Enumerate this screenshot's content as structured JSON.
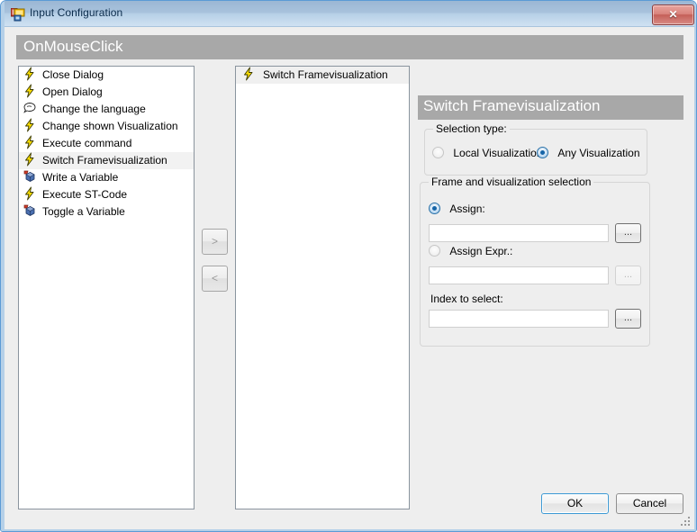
{
  "window": {
    "title": "Input Configuration",
    "icon": "windows-form-icon",
    "close_label": "✕"
  },
  "event_header": {
    "label": "OnMouseClick"
  },
  "available_list": {
    "name": "available-actions-list",
    "items": [
      {
        "label": "Close Dialog",
        "icon": "lightning-icon",
        "selected": false
      },
      {
        "label": "Open Dialog",
        "icon": "lightning-icon",
        "selected": false
      },
      {
        "label": "Change the language",
        "icon": "speech-bubble-icon",
        "selected": false
      },
      {
        "label": "Change shown Visualization",
        "icon": "lightning-icon",
        "selected": false
      },
      {
        "label": "Execute command",
        "icon": "lightning-icon",
        "selected": false
      },
      {
        "label": "Switch Framevisualization",
        "icon": "lightning-icon",
        "selected": true
      },
      {
        "label": "Write a Variable",
        "icon": "variable-icon",
        "selected": false
      },
      {
        "label": "Execute ST-Code",
        "icon": "lightning-icon",
        "selected": false
      },
      {
        "label": "Toggle a Variable",
        "icon": "variable-icon",
        "selected": false
      }
    ]
  },
  "selected_list": {
    "name": "configured-actions-list",
    "items": [
      {
        "label": "Switch Framevisualization",
        "icon": "lightning-icon",
        "selected": true
      }
    ]
  },
  "move_buttons": {
    "add_label": ">",
    "remove_label": "<"
  },
  "action_panel": {
    "title": "Switch Framevisualization",
    "selection_type": {
      "group_label": "Selection type:",
      "options": [
        {
          "label": "Local Visualization",
          "checked": false
        },
        {
          "label": "Any Visualization",
          "checked": true
        }
      ]
    },
    "frame_selection": {
      "group_label": "Frame and visualization selection",
      "assign": {
        "radio_label": "Assign:",
        "checked": true,
        "value": "",
        "browse_label": "...",
        "browse_enabled": true
      },
      "assign_expr": {
        "radio_label": "Assign Expr.:",
        "checked": false,
        "value": "",
        "browse_label": "...",
        "browse_enabled": false
      },
      "index": {
        "label": "Index to select:",
        "value": "",
        "browse_label": "...",
        "browse_enabled": true
      }
    }
  },
  "footer": {
    "ok_label": "OK",
    "cancel_label": "Cancel"
  },
  "colors": {
    "titlebar_gradient_top": "#9bb7d4",
    "titlebar_gradient_bottom": "#cfe1f2",
    "window_border": "#b5d0e8",
    "header_band": "#a8a8a8",
    "client_background": "#eeeeee",
    "close_button": "#c45f58",
    "focus_border": "#3c99d4",
    "radio_checked": "#1665a8"
  }
}
